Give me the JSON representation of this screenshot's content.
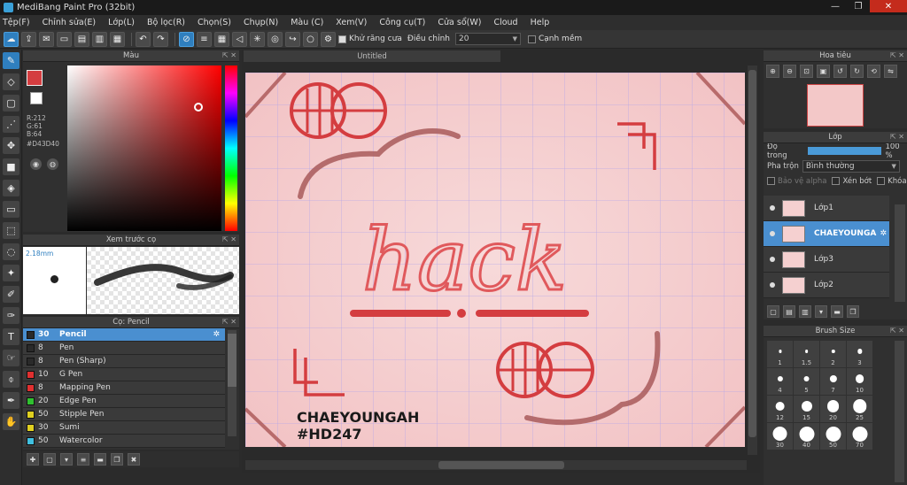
{
  "window": {
    "title": "MediBang Paint Pro (32bit)",
    "minimize": "—",
    "restore": "❐",
    "close": "✕"
  },
  "menu": [
    "Tệp(F)",
    "Chỉnh sửa(E)",
    "Lớp(L)",
    "Bộ lọc(R)",
    "Chọn(S)",
    "Chụp(N)",
    "Màu (C)",
    "Xem(V)",
    "Công cụ(T)",
    "Cửa sổ(W)",
    "Cloud",
    "Help"
  ],
  "toolbar": {
    "antialias_label": "Khử răng cưa",
    "adjust_label": "Điều chỉnh",
    "adjust_value": "20",
    "snap_label": "Cạnh mềm"
  },
  "color_panel": {
    "title": "Màu",
    "fg_color": "#d43d40",
    "r": "R:212",
    "g": "G:61",
    "b": "B:64",
    "hex": "#D43D40"
  },
  "brush_preview": {
    "title": "Xem trước cọ",
    "size": "2.18mm"
  },
  "brush_list": {
    "title": "Cọ: Pencil",
    "items": [
      {
        "size": "30",
        "name": "Pencil",
        "color": "#2a2a2a"
      },
      {
        "size": "8",
        "name": "Pen",
        "color": "#2a2a2a"
      },
      {
        "size": "8",
        "name": "Pen (Sharp)",
        "color": "#2a2a2a"
      },
      {
        "size": "10",
        "name": "G Pen",
        "color": "#e03030"
      },
      {
        "size": "8",
        "name": "Mapping Pen",
        "color": "#e03030"
      },
      {
        "size": "20",
        "name": "Edge Pen",
        "color": "#30c030"
      },
      {
        "size": "50",
        "name": "Stipple Pen",
        "color": "#e0d020"
      },
      {
        "size": "30",
        "name": "Sumi",
        "color": "#e0d020"
      },
      {
        "size": "50",
        "name": "Watercolor",
        "color": "#40c0e0"
      }
    ]
  },
  "document": {
    "tab": "Untitled",
    "art_word": "hack",
    "signature_1": "CHAEYOUNGAH",
    "signature_2": "#HD247"
  },
  "navigator": {
    "title": "Hoa tiêu"
  },
  "layers": {
    "title": "Lớp",
    "opacity_label": "Độ trong",
    "opacity_value": "100 %",
    "blend_label": "Pha trộn",
    "blend_value": "Bình thường",
    "protect_alpha": "Bảo vệ alpha",
    "clipping": "Xén bớt",
    "lock": "Khóa",
    "items": [
      {
        "name": "Lớp1"
      },
      {
        "name": "CHAEYOUNGA"
      },
      {
        "name": "Lớp3"
      },
      {
        "name": "Lớp2"
      }
    ]
  },
  "brush_size": {
    "title": "Brush Size",
    "values": [
      "1",
      "1.5",
      "2",
      "3",
      "4",
      "5",
      "7",
      "10",
      "12",
      "15",
      "20",
      "25",
      "30",
      "40",
      "50",
      "70"
    ]
  }
}
